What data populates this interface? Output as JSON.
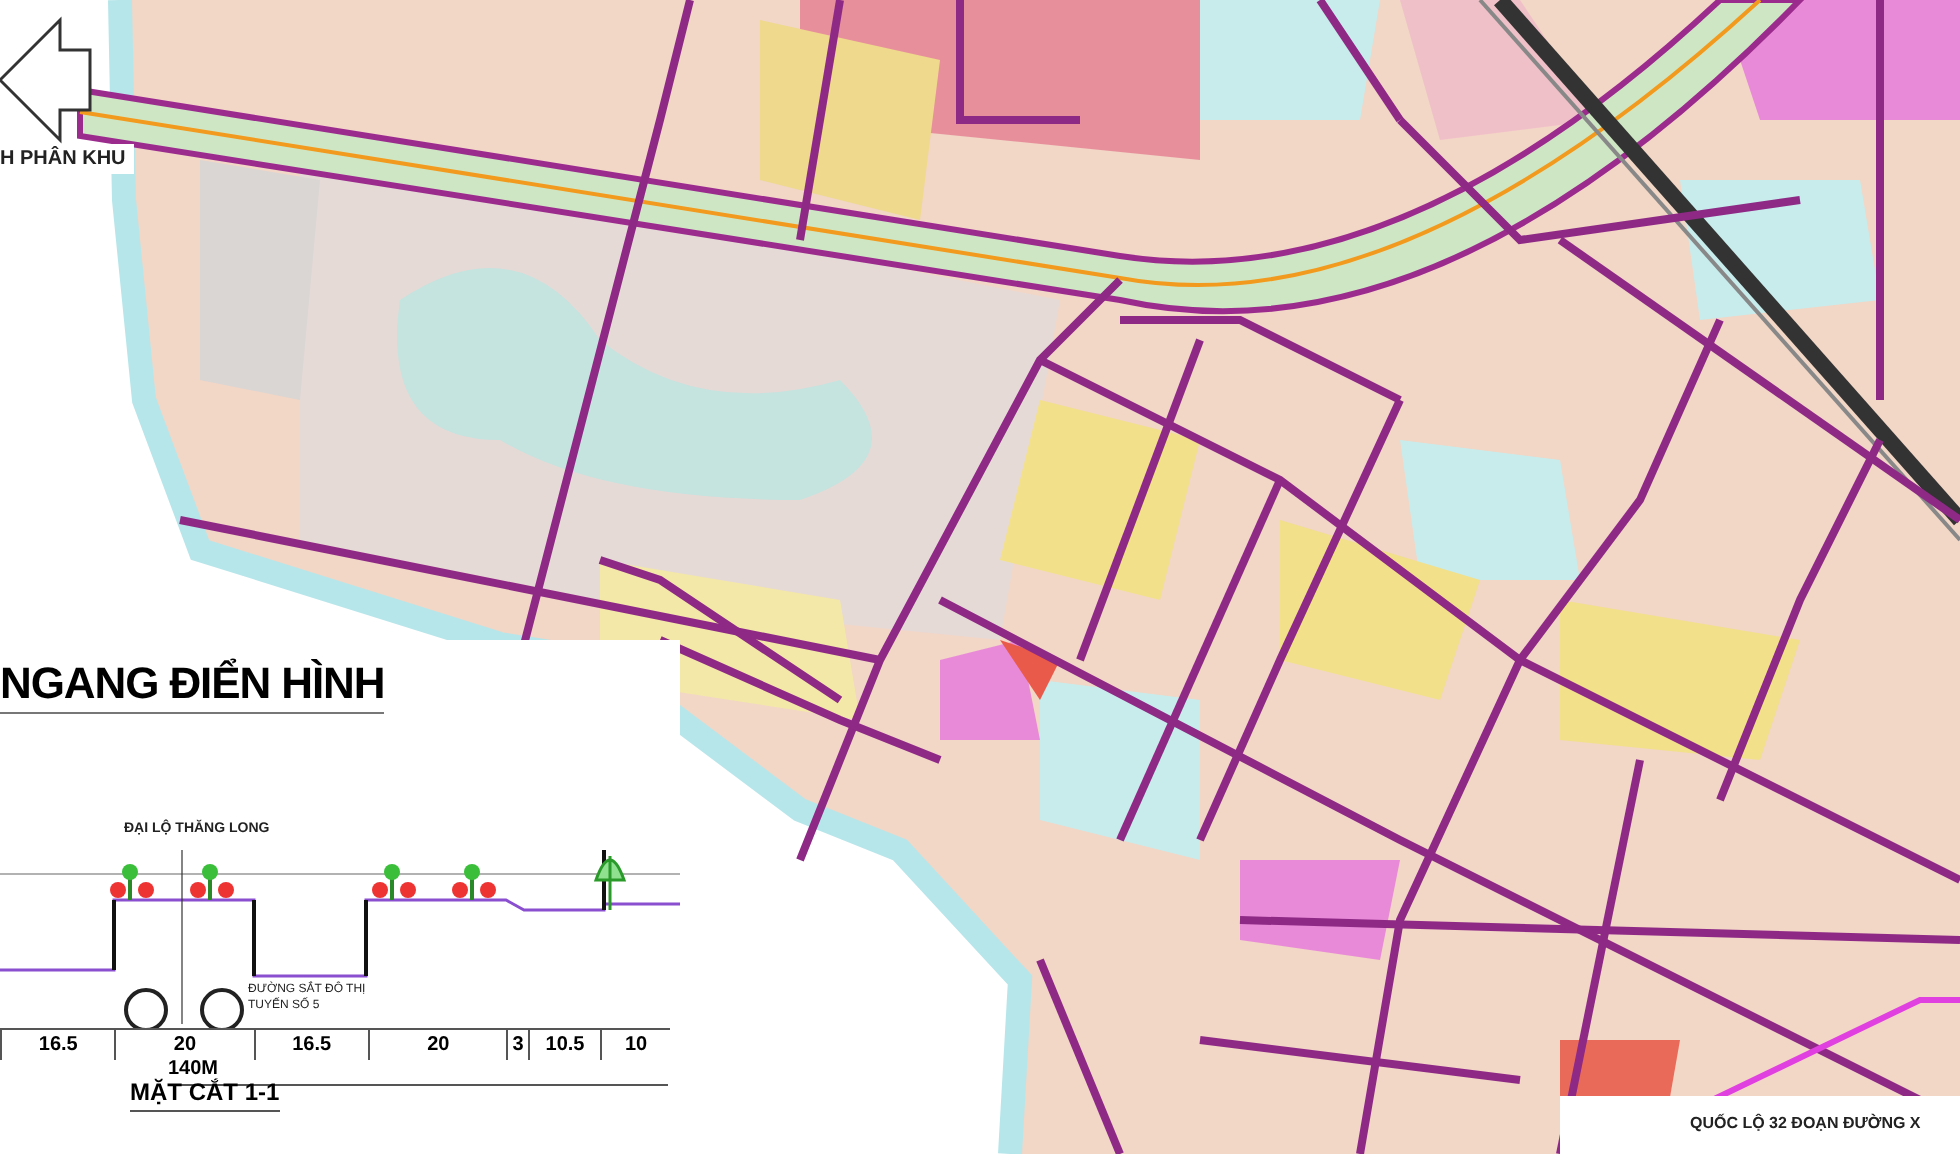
{
  "map": {
    "direction_label": "H PHÂN KHU",
    "road_note": "QUỐC LỘ 32 ĐOẠN ĐƯỜNG X"
  },
  "section": {
    "heading": "NGANG ĐIỂN HÌNH",
    "road_label": "ĐẠI LỘ THĂNG LONG",
    "rail_label": [
      "ĐƯỜNG SẮT ĐÔ THỊ",
      "TUYẾN SỐ 5"
    ],
    "widths": [
      "16.5",
      "20",
      "16.5",
      "20",
      "3",
      "10.5",
      "10"
    ],
    "total": "140M",
    "title": "MẶT CẮT 1-1"
  }
}
